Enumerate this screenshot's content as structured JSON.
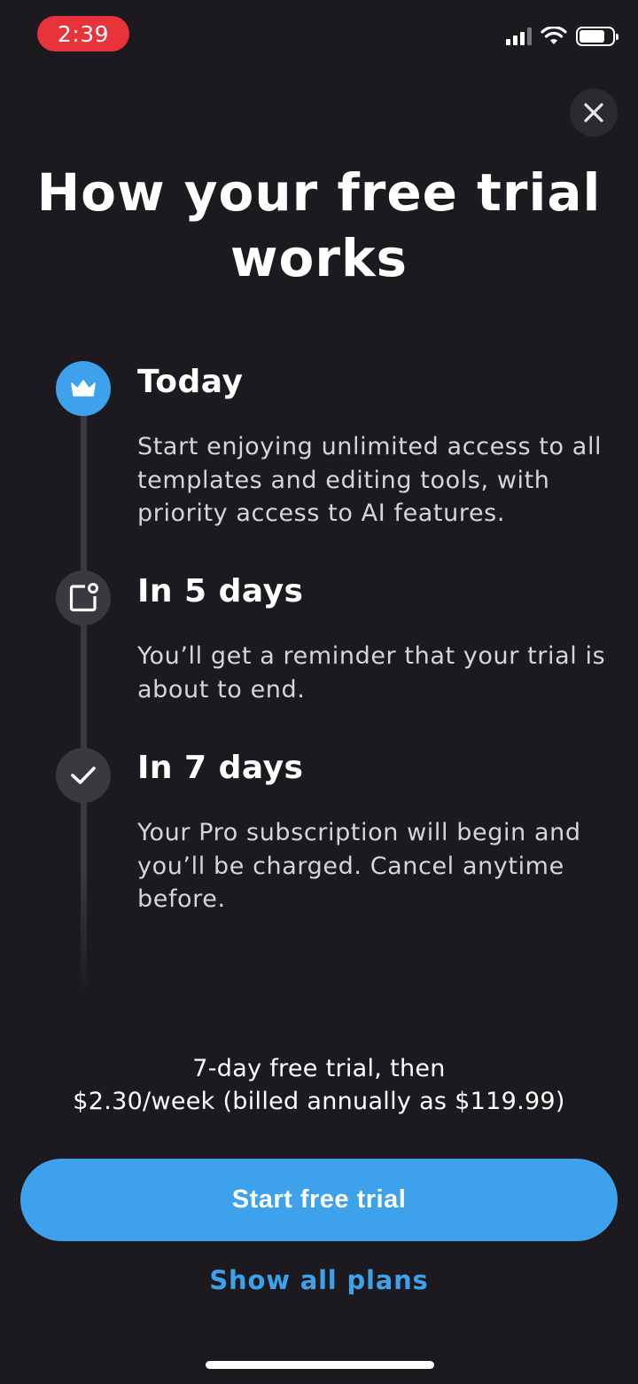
{
  "status_bar": {
    "time": "2:39",
    "time_pill_color": "#e8333a",
    "icons": [
      "signal-icon",
      "wifi-icon",
      "battery-icon"
    ]
  },
  "close_icon": "close-icon",
  "title": "How your free trial works",
  "steps": [
    {
      "icon": "crown-icon",
      "icon_color": "#3da2eb",
      "title": "Today",
      "description": "Start enjoying unlimited access to all templates and editing tools, with priority access to AI features."
    },
    {
      "icon": "notification-icon",
      "icon_color": "#3a393e",
      "title": "In 5 days",
      "description": "You’ll get a reminder that your trial is about to end."
    },
    {
      "icon": "checkmark-icon",
      "icon_color": "#3a393e",
      "title": "In 7 days",
      "description": "Your Pro subscription will begin and you’ll be charged. Cancel anytime before."
    }
  ],
  "pricing": {
    "line1": "7-day free trial, then",
    "line2": "$2.30/week (billed annually as $119.99)"
  },
  "cta": {
    "label": "Start free trial",
    "color": "#3da2eb"
  },
  "secondary_link": "Show all plans",
  "background_color": "#1c1a1f"
}
